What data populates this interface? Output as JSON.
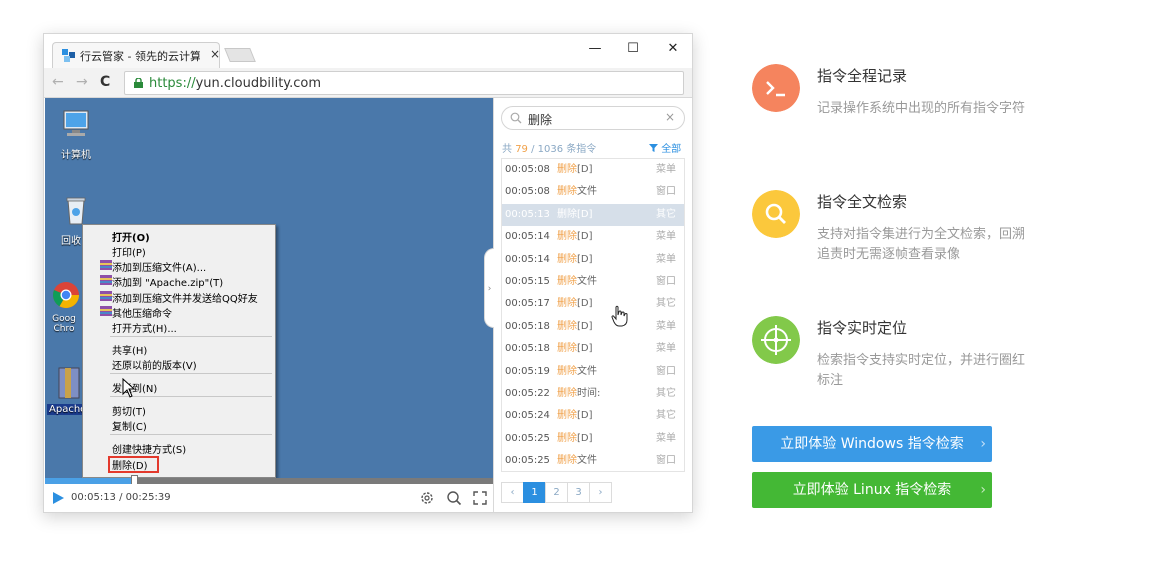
{
  "browser": {
    "tab_title": "行云管家 - 领先的云计算",
    "tab_close": "×",
    "window_controls": {
      "minimize": "—",
      "maximize": "☐",
      "close": "✕"
    },
    "nav": {
      "back": "←",
      "forward": "→",
      "reload": "C"
    },
    "url_scheme": "https://",
    "url_host": "yun.cloudbility.com"
  },
  "desktop": {
    "icons": [
      {
        "label": "计算机",
        "icon": "computer-icon"
      },
      {
        "label": "回收",
        "icon": "recycle-bin-icon"
      },
      {
        "label": "Goog Chro",
        "icon": "chrome-icon"
      },
      {
        "label": "Apache",
        "icon": "zip-file-icon"
      }
    ],
    "context_menu": {
      "open": "打开(O)",
      "print": "打印(P)",
      "add_archive": "添加到压缩文件(A)...",
      "add_to_zip": "添加到 \"Apache.zip\"(T)",
      "add_send_qq": "添加到压缩文件并发送给QQ好友",
      "other_zip": "其他压缩命令",
      "open_with": "打开方式(H)...",
      "share": "共享(H)",
      "restore": "还原以前的版本(V)",
      "send_to": "发送到(N)",
      "cut": "剪切(T)",
      "copy": "复制(C)",
      "shortcut": "创建快捷方式(S)",
      "delete": "删除(D)"
    }
  },
  "player": {
    "current_time": "00:05:13",
    "separator": "/",
    "total_time": "00:25:39",
    "progress_fraction": 0.2
  },
  "panel": {
    "search_value": "删除",
    "search_clear": "×",
    "count_prefix": "共",
    "count_match": "79",
    "count_sep": "/",
    "count_total": "1036",
    "count_suffix": "条指令",
    "filter_label": "全部",
    "collapse_arrow": "›",
    "rows": [
      {
        "time": "00:05:08",
        "keyword": "删除",
        "arg": "[D]",
        "cat": "菜单"
      },
      {
        "time": "00:05:08",
        "keyword": "删除",
        "arg": "文件",
        "cat": "窗口"
      },
      {
        "time": "00:05:13",
        "keyword": "删除",
        "arg": "[D]",
        "cat": "其它",
        "selected": true
      },
      {
        "time": "00:05:14",
        "keyword": "删除",
        "arg": "[D]",
        "cat": "菜单"
      },
      {
        "time": "00:05:14",
        "keyword": "删除",
        "arg": "[D]",
        "cat": "菜单"
      },
      {
        "time": "00:05:15",
        "keyword": "删除",
        "arg": "文件",
        "cat": "窗口"
      },
      {
        "time": "00:05:17",
        "keyword": "删除",
        "arg": "[D]",
        "cat": "其它"
      },
      {
        "time": "00:05:18",
        "keyword": "删除",
        "arg": "[D]",
        "cat": "菜单"
      },
      {
        "time": "00:05:18",
        "keyword": "删除",
        "arg": "[D]",
        "cat": "菜单"
      },
      {
        "time": "00:05:19",
        "keyword": "删除",
        "arg": "文件",
        "cat": "窗口"
      },
      {
        "time": "00:05:22",
        "keyword": "删除",
        "arg": "时间:",
        "cat": "其它"
      },
      {
        "time": "00:05:24",
        "keyword": "删除",
        "arg": "[D]",
        "cat": "其它"
      },
      {
        "time": "00:05:25",
        "keyword": "删除",
        "arg": "[D]",
        "cat": "菜单"
      },
      {
        "time": "00:05:25",
        "keyword": "删除",
        "arg": "文件",
        "cat": "窗口"
      }
    ],
    "pager": {
      "prev": "‹",
      "pages": [
        "1",
        "2",
        "3"
      ],
      "next": "›",
      "current": "1"
    }
  },
  "features": [
    {
      "title": "指令全程记录",
      "desc": "记录操作系统中出现的所有指令字符",
      "icon": "terminal-icon",
      "color": "#f5845e"
    },
    {
      "title": "指令全文检索",
      "desc": "支持对指令集进行为全文检索，回溯追责时无需逐帧查看录像",
      "icon": "search-icon",
      "color": "#fbc83c"
    },
    {
      "title": "指令实时定位",
      "desc": "检索指令支持实时定位，并进行圈红标注",
      "icon": "crosshair-icon",
      "color": "#82c94a"
    }
  ],
  "cta": {
    "windows": "立即体验 Windows 指令检索",
    "linux": "立即体验 Linux 指令检索",
    "arrow": "›",
    "windows_color": "#3a9ae6",
    "linux_color": "#44b835"
  }
}
